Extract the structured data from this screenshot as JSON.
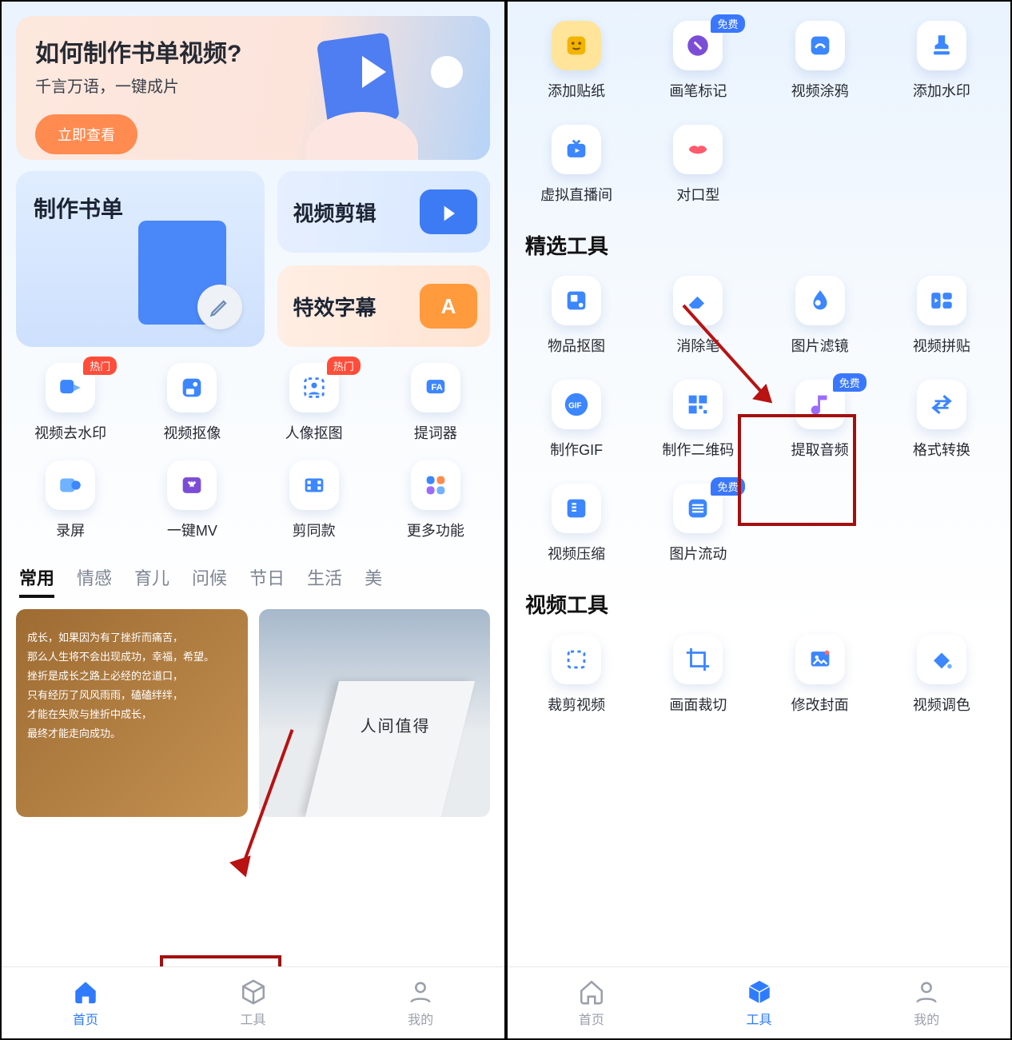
{
  "left": {
    "banner": {
      "title": "如何制作书单视频?",
      "subtitle": "千言万语，一键成片",
      "cta": "立即查看"
    },
    "big": {
      "makeList": "制作书单",
      "videoEdit": "视频剪辑",
      "fxSub": "特效字幕"
    },
    "badges": {
      "hot": "热门"
    },
    "grid": [
      {
        "label": "视频去水印",
        "badge": "hot"
      },
      {
        "label": "视频抠像"
      },
      {
        "label": "人像抠图",
        "badge": "hot"
      },
      {
        "label": "提词器"
      },
      {
        "label": "录屏"
      },
      {
        "label": "一键MV"
      },
      {
        "label": "剪同款"
      },
      {
        "label": "更多功能"
      }
    ],
    "categories": [
      "常用",
      "情感",
      "育儿",
      "问候",
      "节日",
      "生活",
      "美"
    ],
    "card1_lines": [
      "成长，如果因为有了挫折而痛苦，",
      "那么人生将不会出现成功，幸福，希望。",
      "挫折是成长之路上必经的岔道口，",
      "只有经历了风风雨雨，磕磕绊绊，",
      "才能在失败与挫折中成长，",
      "最终才能走向成功。"
    ],
    "card2_title": "人间值得",
    "nav": [
      "首页",
      "工具",
      "我的"
    ]
  },
  "right": {
    "badges": {
      "free": "免费"
    },
    "row1": [
      {
        "label": "添加贴纸"
      },
      {
        "label": "画笔标记",
        "badge": "free"
      },
      {
        "label": "视频涂鸦"
      },
      {
        "label": "添加水印"
      }
    ],
    "row2": [
      {
        "label": "虚拟直播间"
      },
      {
        "label": "对口型"
      }
    ],
    "sect1": "精选工具",
    "row3": [
      {
        "label": "物品抠图"
      },
      {
        "label": "消除笔"
      },
      {
        "label": "图片滤镜"
      },
      {
        "label": "视频拼贴"
      }
    ],
    "row4": [
      {
        "label": "制作GIF"
      },
      {
        "label": "制作二维码"
      },
      {
        "label": "提取音频",
        "badge": "free"
      },
      {
        "label": "格式转换"
      }
    ],
    "row5": [
      {
        "label": "视频压缩"
      },
      {
        "label": "图片流动",
        "badge": "free"
      }
    ],
    "sect2": "视频工具",
    "row6": [
      {
        "label": "裁剪视频"
      },
      {
        "label": "画面裁切"
      },
      {
        "label": "修改封面"
      },
      {
        "label": "视频调色"
      }
    ],
    "nav": [
      "首页",
      "工具",
      "我的"
    ]
  }
}
